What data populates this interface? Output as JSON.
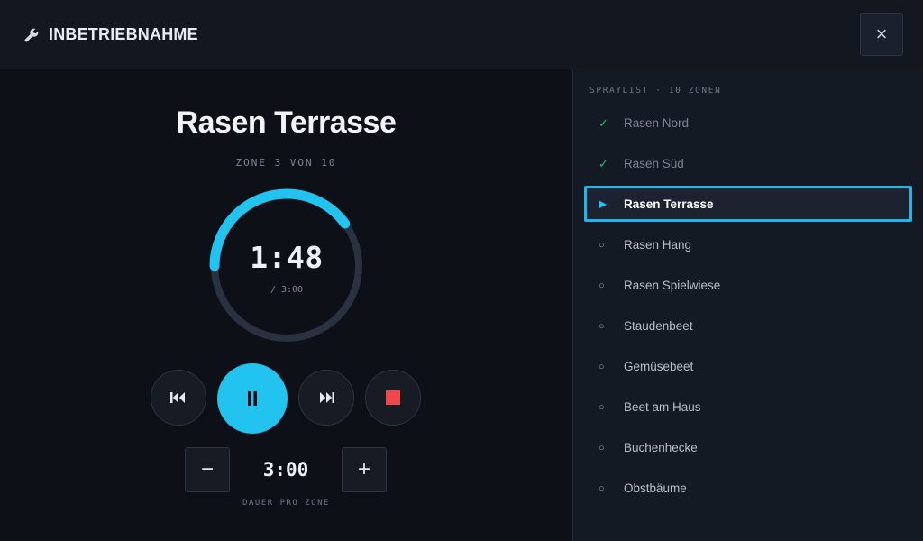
{
  "header": {
    "title": "INBETRIEBNAHME",
    "icon": "wrench-icon",
    "close_label": "×"
  },
  "current": {
    "zone_name": "Rasen Terrasse",
    "zone_position": "ZONE 3 VON 10",
    "remaining": "1:48",
    "total": "/ 3:00",
    "progress_fraction": 0.4
  },
  "controls": {
    "previous_icon": "skip-previous-icon",
    "pause_icon": "pause-icon",
    "next_icon": "skip-next-icon",
    "stop_icon": "stop-icon"
  },
  "duration": {
    "minus_label": "−",
    "value": "3:00",
    "plus_label": "+",
    "caption": "DAUER PRO ZONE"
  },
  "spraylist": {
    "header": "SPRAYLIST · 10 ZONEN",
    "items": [
      {
        "label": "Rasen Nord",
        "status": "done",
        "mark": "✓"
      },
      {
        "label": "Rasen Süd",
        "status": "done",
        "mark": "✓"
      },
      {
        "label": "Rasen Terrasse",
        "status": "active",
        "mark": "▶"
      },
      {
        "label": "Rasen Hang",
        "status": "pending",
        "mark": "○"
      },
      {
        "label": "Rasen Spielwiese",
        "status": "pending",
        "mark": "○"
      },
      {
        "label": "Staudenbeet",
        "status": "pending",
        "mark": "○"
      },
      {
        "label": "Gemüsebeet",
        "status": "pending",
        "mark": "○"
      },
      {
        "label": "Beet am Haus",
        "status": "pending",
        "mark": "○"
      },
      {
        "label": "Buchenhecke",
        "status": "pending",
        "mark": "○"
      },
      {
        "label": "Obstbäume",
        "status": "pending",
        "mark": "○"
      }
    ]
  },
  "colors": {
    "accent": "#22c3ee",
    "done": "#22c55e",
    "stop": "#f04848",
    "ring_track": "#2a3140"
  }
}
